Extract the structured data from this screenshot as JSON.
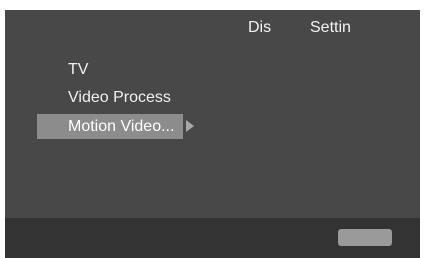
{
  "header": {
    "tabs": [
      {
        "label": "Dis"
      },
      {
        "label": "Settin"
      }
    ]
  },
  "menu": {
    "items": [
      {
        "label": "TV",
        "selected": false
      },
      {
        "label": "Video Process",
        "selected": false
      },
      {
        "label": "Motion Video...",
        "selected": true,
        "has_submenu": true
      }
    ]
  },
  "colors": {
    "background": "#484848",
    "footer": "#333333",
    "selection": "#8c8c8c",
    "text": "#f0f0f0"
  }
}
